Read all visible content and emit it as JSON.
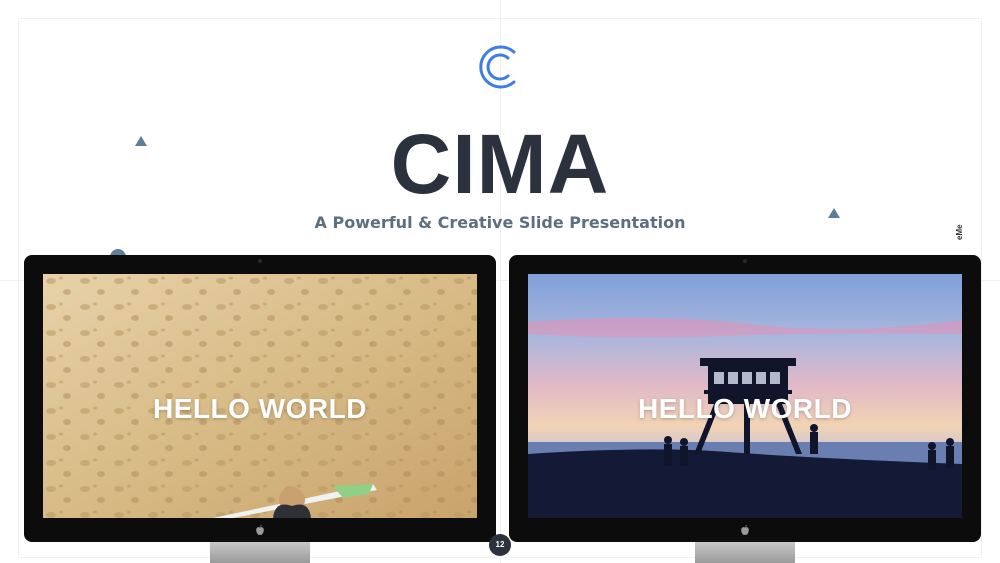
{
  "slide": {
    "title": "CIMA",
    "subtitle": "A Powerful & Creative Slide Presentation",
    "side_brand": "eMe",
    "page_number": "12"
  },
  "monitors": [
    {
      "screen_text": "HELLO WORLD",
      "image": "sand-footprints-surfer-photo"
    },
    {
      "screen_text": "HELLO WORLD",
      "image": "beach-sunset-lifeguard-tower-photo"
    }
  ],
  "colors": {
    "title": "#2c323d",
    "subtitle": "#5c6f82",
    "accent_blue": "#3d7fe0",
    "shape_accent": "#5e7f97"
  },
  "icons": [
    "c-logo-icon",
    "triangle-shape",
    "circle-shape",
    "apple-logo-icon"
  ]
}
